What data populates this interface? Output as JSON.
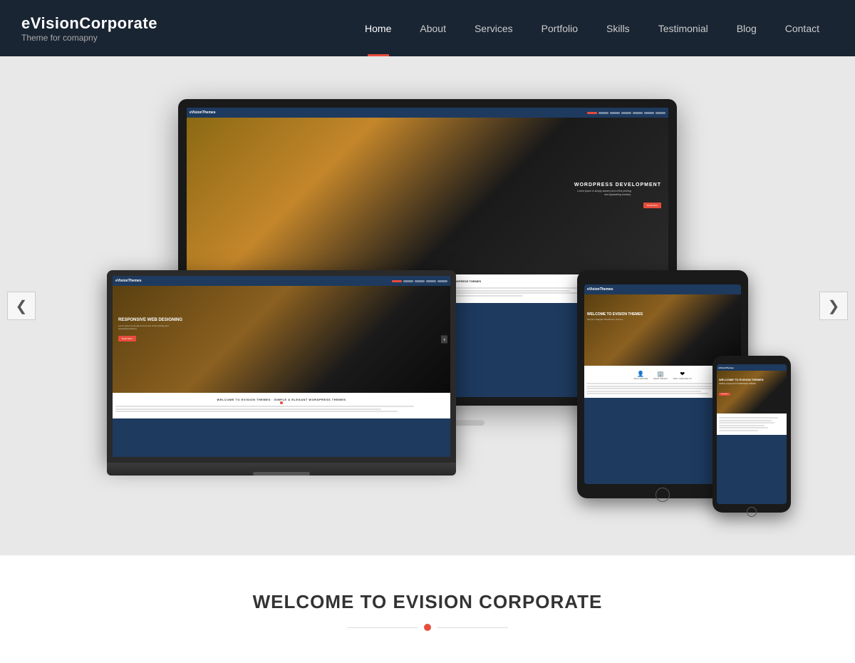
{
  "brand": {
    "name": "eVisionCorporate",
    "tagline": "Theme for comapny"
  },
  "nav": {
    "items": [
      {
        "label": "Home",
        "active": true
      },
      {
        "label": "About",
        "active": false
      },
      {
        "label": "Services",
        "active": false
      },
      {
        "label": "Portfolio",
        "active": false
      },
      {
        "label": "Skills",
        "active": false
      },
      {
        "label": "Testimonial",
        "active": false
      },
      {
        "label": "Blog",
        "active": false
      },
      {
        "label": "Contact",
        "active": false
      }
    ]
  },
  "slider": {
    "left_arrow": "❮",
    "right_arrow": "❯"
  },
  "monitor_screen": {
    "nav_logo": "eVisionThemes",
    "hero_title": "WORDPRESS DEVELOPMENT",
    "hero_desc": "Lorem ipsum is simply dummy text of the printing and typesetting industry.",
    "hero_btn": "Read More"
  },
  "laptop_screen": {
    "hero_title": "RESPONSIVE WEB DESIGNING",
    "welcome_title": "WELCOME TO EVISION THEMES - SIMPLE & ELEGANT WORDPRESS THEMES",
    "welcome_text": "eVision Themes, A leading web design and development company based in Kathmandu, Nepal."
  },
  "welcome": {
    "title": "WELCOME TO EVISION CORPORATE",
    "divider_dot": "•"
  }
}
